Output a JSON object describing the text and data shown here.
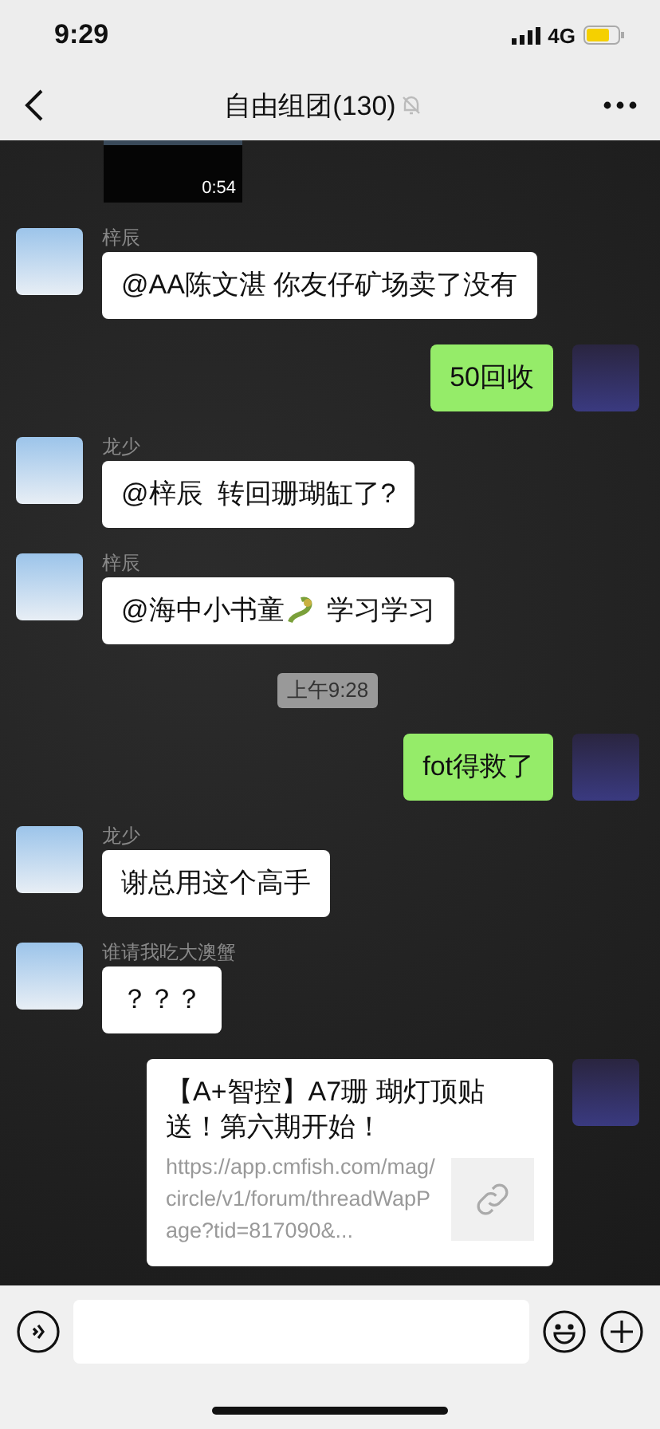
{
  "status_bar": {
    "time": "9:29",
    "network": "4G"
  },
  "nav": {
    "title": "自由组团(130)",
    "muted": true
  },
  "messages": [
    {
      "kind": "video",
      "duration": "0:54"
    },
    {
      "kind": "text",
      "outgoing": false,
      "sender": "梓辰",
      "segments": [
        {
          "kind": "text",
          "text": "@AA陈文湛 你友仔矿场卖了没有"
        }
      ]
    },
    {
      "kind": "text",
      "outgoing": true,
      "segments": [
        {
          "kind": "text",
          "text": "50回收"
        }
      ]
    },
    {
      "kind": "text",
      "outgoing": false,
      "sender": "龙少",
      "segments": [
        {
          "kind": "text",
          "text": "@梓辰  转回珊瑚缸了?"
        }
      ]
    },
    {
      "kind": "text",
      "outgoing": false,
      "sender": "梓辰",
      "segments": [
        {
          "kind": "text",
          "text": "@海中小书童"
        },
        {
          "kind": "sticker"
        },
        {
          "kind": "text",
          "text": " 学习学习"
        }
      ]
    },
    {
      "kind": "time",
      "text": "上午9:28"
    },
    {
      "kind": "text",
      "outgoing": true,
      "segments": [
        {
          "kind": "text",
          "text": "fot得救了"
        }
      ]
    },
    {
      "kind": "text",
      "outgoing": false,
      "sender": "龙少",
      "segments": [
        {
          "kind": "text",
          "text": "谢总用这个高手"
        }
      ]
    },
    {
      "kind": "text",
      "outgoing": false,
      "sender": "谁请我吃大澳蟹",
      "segments": [
        {
          "kind": "text",
          "text": "？？？"
        }
      ]
    },
    {
      "kind": "link",
      "outgoing": true,
      "title": "【A+智控】A7珊 瑚灯顶贴送！第六期开始！",
      "url": "https://app.cmfish.com/mag/circle/v1/forum/threadWapPage?tid=817090&..."
    }
  ]
}
